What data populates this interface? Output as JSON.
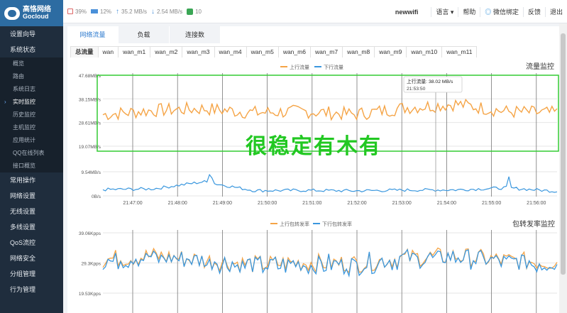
{
  "brand": {
    "name_cn": "高恪网络",
    "name_en": "Gocloud"
  },
  "sidebar": {
    "items": [
      {
        "label": "设置向导",
        "type": "main"
      },
      {
        "label": "系统状态",
        "type": "main"
      },
      {
        "label": "概览",
        "type": "sub"
      },
      {
        "label": "路由",
        "type": "sub"
      },
      {
        "label": "系统日志",
        "type": "sub"
      },
      {
        "label": "实时监控",
        "type": "sub",
        "active": true
      },
      {
        "label": "历史监控",
        "type": "sub"
      },
      {
        "label": "主机监控",
        "type": "sub"
      },
      {
        "label": "应用统计",
        "type": "sub"
      },
      {
        "label": "QQ在线列表",
        "type": "sub"
      },
      {
        "label": "接口概览",
        "type": "sub"
      },
      {
        "label": "常用操作",
        "type": "main"
      },
      {
        "label": "网络设置",
        "type": "main"
      },
      {
        "label": "无线设置",
        "type": "main"
      },
      {
        "label": "多线设置",
        "type": "main"
      },
      {
        "label": "QoS流控",
        "type": "main"
      },
      {
        "label": "网络安全",
        "type": "main"
      },
      {
        "label": "分组管理",
        "type": "main"
      },
      {
        "label": "行为管理",
        "type": "main"
      }
    ]
  },
  "topbar": {
    "cpu": "39%",
    "mem": "12%",
    "upload": "35.2 MB/s",
    "download": "2.54 MB/s",
    "online": "10",
    "device": "newwifi",
    "lang": "语言",
    "help": "帮助",
    "wechat": "微信绑定",
    "feedback": "反馈",
    "logout": "退出"
  },
  "tabs_top": [
    "网络流量",
    "负载",
    "连接数"
  ],
  "tabs_iface": [
    "总流量",
    "wan",
    "wan_m1",
    "wan_m2",
    "wan_m3",
    "wan_m4",
    "wan_m5",
    "wan_m6",
    "wan_m7",
    "wan_m8",
    "wan_m9",
    "wan_m10",
    "wan_m11"
  ],
  "overlay_text": "很稳定有木有",
  "traffic": {
    "title": "流量监控",
    "legend": [
      "上行流量",
      "下行流量"
    ],
    "yticks": [
      "47.68MB/s",
      "38.15MB/s",
      "28.61MB/s",
      "19.07MB/s",
      "9.54MB/s",
      "0B/s"
    ],
    "xticks": [
      "21:47:00",
      "21:48:00",
      "21:49:00",
      "21:50:00",
      "21:51:00",
      "21:52:00",
      "21:53:00",
      "21:54:00",
      "21:55:00",
      "21:56:00"
    ],
    "tooltip": {
      "line1": "上行流量: 38.02 MB/s",
      "line2": "21:53:50"
    }
  },
  "packets": {
    "title": "包转发率监控",
    "legend": [
      "上行包转发率",
      "下行包转发率"
    ],
    "yticks": [
      "39.06Kpps",
      "29.3Kpps",
      "19.53Kpps"
    ]
  },
  "colors": {
    "up": "#f5a446",
    "down": "#3a97de",
    "highlight": "#33cc33",
    "overlay": "#22c822"
  },
  "chart_data": [
    {
      "type": "line",
      "title": "流量监控",
      "ylabel": "",
      "ylim": [
        0,
        47.68
      ],
      "x": [
        "21:47:00",
        "21:48:00",
        "21:49:00",
        "21:50:00",
        "21:51:00",
        "21:52:00",
        "21:53:00",
        "21:54:00",
        "21:55:00",
        "21:56:00"
      ],
      "series": [
        {
          "name": "上行流量",
          "values": [
            31.8,
            33.5,
            34.2,
            32.6,
            33.1,
            31.9,
            34.6,
            36.1,
            33.0,
            32.4
          ]
        },
        {
          "name": "下行流量",
          "values": [
            2.5,
            2.8,
            5.6,
            2.1,
            2.2,
            2.0,
            2.3,
            2.4,
            3.2,
            1.8
          ]
        }
      ]
    },
    {
      "type": "line",
      "title": "包转发率监控",
      "ylabel": "",
      "ylim": [
        19.53,
        39.06
      ],
      "x": [
        "21:47:00",
        "21:48:00",
        "21:49:00",
        "21:50:00",
        "21:51:00",
        "21:52:00",
        "21:53:00",
        "21:54:00",
        "21:55:00",
        "21:56:00"
      ],
      "series": [
        {
          "name": "上行包转发率",
          "values": [
            30.5,
            31.6,
            30.2,
            28.8,
            29.4,
            29.1,
            31.0,
            31.5,
            30.0,
            29.6
          ]
        },
        {
          "name": "下行包转发率",
          "values": [
            30.0,
            31.0,
            29.8,
            28.4,
            29.0,
            28.9,
            30.6,
            31.0,
            29.7,
            29.2
          ]
        }
      ]
    }
  ]
}
